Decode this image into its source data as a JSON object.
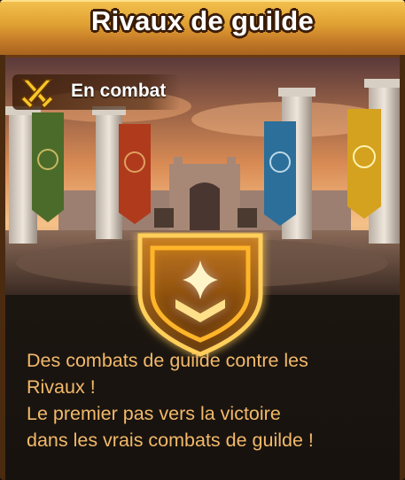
{
  "header": {
    "title": "Rivaux de guilde"
  },
  "status": {
    "label": "En combat",
    "icon": "crossed-swords-icon"
  },
  "emblem": {
    "icon": "guild-shield-emblem-icon"
  },
  "description": {
    "line1": "Des combats de guilde contre les",
    "line2": "Rivaux !",
    "line3": "Le premier pas vers la victoire",
    "line4": "dans les vrais combats de guilde !"
  },
  "colors": {
    "header_gold": "#e0a033",
    "text_orange": "#f2b96a",
    "emblem_glow": "#ffb300"
  }
}
